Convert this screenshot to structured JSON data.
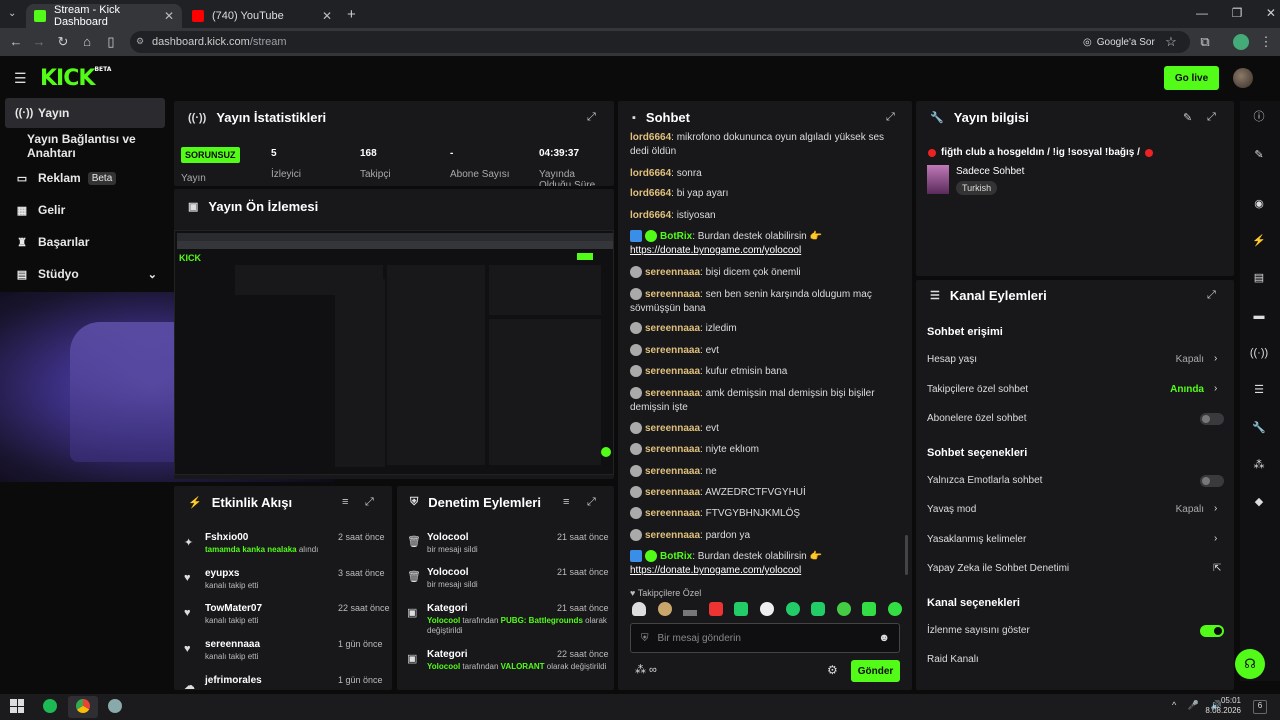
{
  "browser": {
    "tabs": [
      {
        "label": "Stream - Kick Dashboard"
      },
      {
        "label": "(740) YouTube"
      }
    ],
    "url_host": "dashboard.kick.com",
    "url_path": "/stream",
    "google_ask": "Google'a Sor"
  },
  "header": {
    "logo": "KICK",
    "logo_sup": "BETA",
    "go_live": "Go live"
  },
  "sidebar": {
    "items": [
      {
        "label": "Yayın",
        "icon": "broadcast-icon"
      },
      {
        "label": "Yayın Bağlantısı ve Anahtarı"
      },
      {
        "label": "Reklam",
        "badge": "Beta",
        "icon": "ad-icon"
      },
      {
        "label": "Gelir",
        "icon": "revenue-icon"
      },
      {
        "label": "Başarılar",
        "icon": "trophy-icon"
      },
      {
        "label": "Stüdyo",
        "icon": "studio-icon"
      }
    ]
  },
  "stats": {
    "title": "Yayın İstatistikleri",
    "status": "SORUNSUZ",
    "status_label": "Yayın",
    "items": [
      {
        "value": "5",
        "label": "İzleyici"
      },
      {
        "value": "168",
        "label": "Takipçi"
      },
      {
        "value": "-",
        "label": "Abone Sayısı"
      },
      {
        "value": "04:39:37",
        "label": "Yayında Olduğu Süre"
      }
    ]
  },
  "preview": {
    "title": "Yayın Ön İzlemesi"
  },
  "activity": {
    "title": "Etkinlik Akışı",
    "items": [
      {
        "name": "Fshxio00",
        "sub_highlight": "tamamda kanka nealaka",
        "sub_rest": " alındı",
        "time": "2 saat önce"
      },
      {
        "name": "eyupxs",
        "sub_rest": "kanalı takip etti",
        "time": "3 saat önce"
      },
      {
        "name": "TowMater07",
        "sub_rest": "kanalı takip etti",
        "time": "22 saat önce"
      },
      {
        "name": "sereennaaa",
        "sub_rest": "kanalı takip etti",
        "time": "1 gün önce"
      },
      {
        "name": "jefrimorales",
        "sub_rest": "",
        "time": "1 gün önce"
      }
    ]
  },
  "moderation": {
    "title": "Denetim Eylemleri",
    "items": [
      {
        "name": "Yolocool",
        "line1": "bir mesajı sildi",
        "time": "21 saat önce"
      },
      {
        "name": "Yolocool",
        "line1": "bir mesajı sildi",
        "time": "21 saat önce"
      },
      {
        "name": "Kategori",
        "hl1": "Yolocool",
        "mid": " tarafından ",
        "hl2": "PUBG: Battlegrounds",
        "end": " olarak değiştirildi",
        "time": "21 saat önce"
      },
      {
        "name": "Kategori",
        "hl1": "Yolocool",
        "mid": " tarafından ",
        "hl2": "VALORANT",
        "end": " olarak değiştirildi",
        "time": "22 saat önce"
      }
    ]
  },
  "chat": {
    "title": "Sohbet",
    "messages": [
      {
        "user": "lord6664",
        "text": "mikrofono dokununca oyun algıladı yüksek ses dedi öldün"
      },
      {
        "user": "lord6664",
        "text": "sonra"
      },
      {
        "user": "lord6664",
        "text": "bi yap ayarı"
      },
      {
        "user": "lord6664",
        "text": "istiyosan"
      },
      {
        "user": "BotRix",
        "text": "Burdan destek olabilirsin 👉",
        "link": "https://donate.bynogame.com/yolocool",
        "bot": true
      },
      {
        "user": "sereennaaa",
        "text": "bişi dicem çok önemli"
      },
      {
        "user": "sereennaaa",
        "text": "sen ben senin karşında oldugum maç sövmüşşün bana"
      },
      {
        "user": "sereennaaa",
        "text": "izledim"
      },
      {
        "user": "sereennaaa",
        "text": "evt"
      },
      {
        "user": "sereennaaa",
        "text": "kufur etmisin bana"
      },
      {
        "user": "sereennaaa",
        "text": "amk demişsin mal demişsin bişi bişiler demişsin işte"
      },
      {
        "user": "sereennaaa",
        "text": "evt"
      },
      {
        "user": "sereennaaa",
        "text": "niyte eklıom"
      },
      {
        "user": "sereennaaa",
        "text": "ne"
      },
      {
        "user": "sereennaaa",
        "text": "AWZEDRCTFVGYHUİ"
      },
      {
        "user": "sereennaaa",
        "text": "FTVGYBHNJKMLÖŞ"
      },
      {
        "user": "sereennaaa",
        "text": "pardon ya"
      },
      {
        "user": "BotRix",
        "text": "Burdan destek olabilirsin 👉",
        "link": "https://donate.bynogame.com/yolocool",
        "bot": true
      }
    ],
    "followers_only": "Takipçilere Özel",
    "input_placeholder": "Bir mesaj gönderin",
    "send": "Gönder"
  },
  "stream_info": {
    "title": "Yayın bilgisi",
    "stream_title": "fiğth club a hosgeldın / !ig !sosyal !bağış /",
    "category": "Sadece Sohbet",
    "language": "Turkish"
  },
  "channel_actions": {
    "title": "Kanal Eylemleri",
    "chat_access": "Sohbet erişimi",
    "rows1": [
      {
        "label": "Hesap yaşı",
        "value": "Kapalı"
      },
      {
        "label": "Takipçilere özel sohbet",
        "value": "Anında"
      },
      {
        "label": "Abonelere özel sohbet",
        "toggle": false
      }
    ],
    "chat_options": "Sohbet seçenekleri",
    "rows2": [
      {
        "label": "Yalnızca Emotlarla sohbet",
        "toggle": false
      },
      {
        "label": "Yavaş mod",
        "value": "Kapalı"
      },
      {
        "label": "Yasaklanmış kelimeler"
      },
      {
        "label": "Yapay Zeka ile Sohbet Denetimi"
      }
    ],
    "channel_options": "Kanal seçenekleri",
    "rows3": [
      {
        "label": "İzlenme sayısını göster",
        "toggle": true
      },
      {
        "label": "Raid Kanalı"
      }
    ]
  },
  "taskbar": {
    "time": "05:01",
    "date": "8.08.2026"
  },
  "colors": {
    "accent": "#53fc18",
    "panel": "#18181b",
    "bg": "#0b0b0c"
  }
}
